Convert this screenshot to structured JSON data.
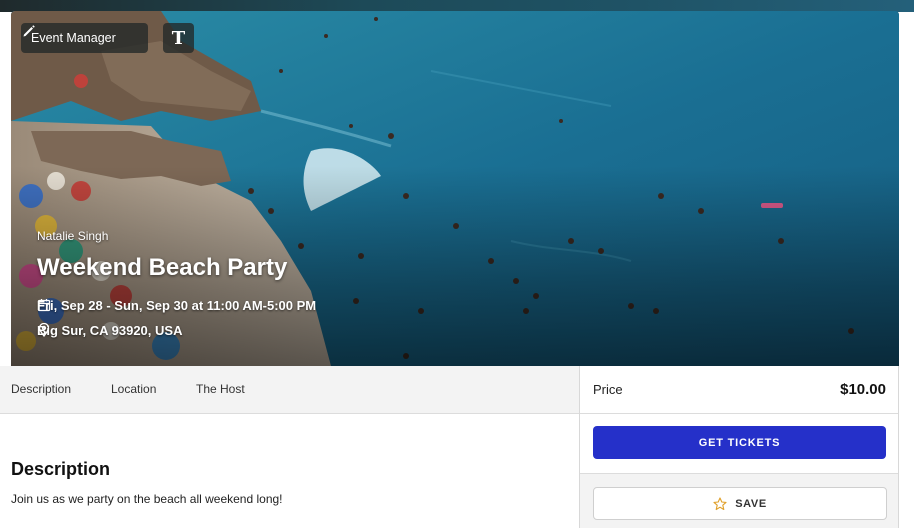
{
  "hero": {
    "manager_label": "Event Manager",
    "text_toggle_label": "T",
    "host_name": "Natalie Singh",
    "title": "Weekend Beach Party",
    "date_time": "Fri, Sep 28 - Sun, Sep 30 at 11:00 AM-5:00 PM",
    "location": "Big Sur, CA 93920, USA",
    "icons": [
      "pencil-icon",
      "calendar-icon",
      "location-pin-icon"
    ]
  },
  "tabs": [
    {
      "label": "Description"
    },
    {
      "label": "Location"
    },
    {
      "label": "The Host"
    }
  ],
  "description": {
    "heading": "Description",
    "body": "Join us as we party on the beach all weekend long!"
  },
  "purchase": {
    "price_label": "Price",
    "price_value": "$10.00",
    "tickets_button": "GET TICKETS",
    "save_button": "SAVE",
    "icons": [
      "star-icon"
    ]
  },
  "colors": {
    "accent": "#2530c9",
    "star": "#e0a02a",
    "sea": "#1b6688"
  }
}
